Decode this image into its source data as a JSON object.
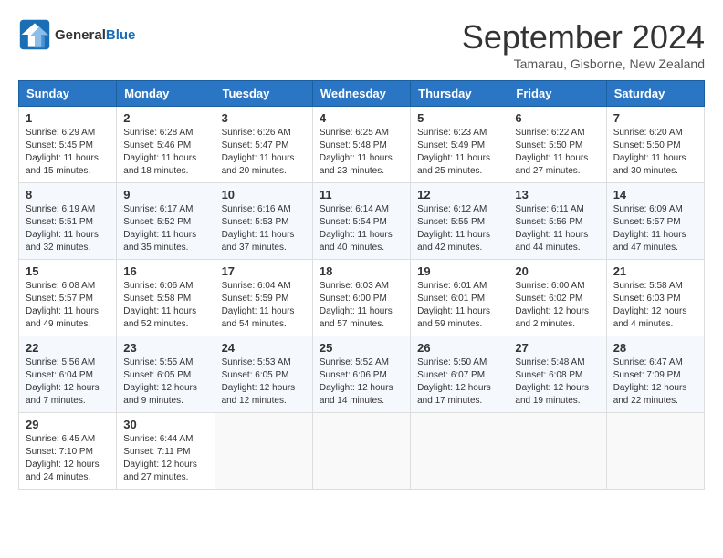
{
  "header": {
    "logo_general": "General",
    "logo_blue": "Blue",
    "month_title": "September 2024",
    "location": "Tamarau, Gisborne, New Zealand"
  },
  "weekdays": [
    "Sunday",
    "Monday",
    "Tuesday",
    "Wednesday",
    "Thursday",
    "Friday",
    "Saturday"
  ],
  "weeks": [
    [
      {
        "day": "1",
        "sunrise": "6:29 AM",
        "sunset": "5:45 PM",
        "daylight": "11 hours and 15 minutes."
      },
      {
        "day": "2",
        "sunrise": "6:28 AM",
        "sunset": "5:46 PM",
        "daylight": "11 hours and 18 minutes."
      },
      {
        "day": "3",
        "sunrise": "6:26 AM",
        "sunset": "5:47 PM",
        "daylight": "11 hours and 20 minutes."
      },
      {
        "day": "4",
        "sunrise": "6:25 AM",
        "sunset": "5:48 PM",
        "daylight": "11 hours and 23 minutes."
      },
      {
        "day": "5",
        "sunrise": "6:23 AM",
        "sunset": "5:49 PM",
        "daylight": "11 hours and 25 minutes."
      },
      {
        "day": "6",
        "sunrise": "6:22 AM",
        "sunset": "5:50 PM",
        "daylight": "11 hours and 27 minutes."
      },
      {
        "day": "7",
        "sunrise": "6:20 AM",
        "sunset": "5:50 PM",
        "daylight": "11 hours and 30 minutes."
      }
    ],
    [
      {
        "day": "8",
        "sunrise": "6:19 AM",
        "sunset": "5:51 PM",
        "daylight": "11 hours and 32 minutes."
      },
      {
        "day": "9",
        "sunrise": "6:17 AM",
        "sunset": "5:52 PM",
        "daylight": "11 hours and 35 minutes."
      },
      {
        "day": "10",
        "sunrise": "6:16 AM",
        "sunset": "5:53 PM",
        "daylight": "11 hours and 37 minutes."
      },
      {
        "day": "11",
        "sunrise": "6:14 AM",
        "sunset": "5:54 PM",
        "daylight": "11 hours and 40 minutes."
      },
      {
        "day": "12",
        "sunrise": "6:12 AM",
        "sunset": "5:55 PM",
        "daylight": "11 hours and 42 minutes."
      },
      {
        "day": "13",
        "sunrise": "6:11 AM",
        "sunset": "5:56 PM",
        "daylight": "11 hours and 44 minutes."
      },
      {
        "day": "14",
        "sunrise": "6:09 AM",
        "sunset": "5:57 PM",
        "daylight": "11 hours and 47 minutes."
      }
    ],
    [
      {
        "day": "15",
        "sunrise": "6:08 AM",
        "sunset": "5:57 PM",
        "daylight": "11 hours and 49 minutes."
      },
      {
        "day": "16",
        "sunrise": "6:06 AM",
        "sunset": "5:58 PM",
        "daylight": "11 hours and 52 minutes."
      },
      {
        "day": "17",
        "sunrise": "6:04 AM",
        "sunset": "5:59 PM",
        "daylight": "11 hours and 54 minutes."
      },
      {
        "day": "18",
        "sunrise": "6:03 AM",
        "sunset": "6:00 PM",
        "daylight": "11 hours and 57 minutes."
      },
      {
        "day": "19",
        "sunrise": "6:01 AM",
        "sunset": "6:01 PM",
        "daylight": "11 hours and 59 minutes."
      },
      {
        "day": "20",
        "sunrise": "6:00 AM",
        "sunset": "6:02 PM",
        "daylight": "12 hours and 2 minutes."
      },
      {
        "day": "21",
        "sunrise": "5:58 AM",
        "sunset": "6:03 PM",
        "daylight": "12 hours and 4 minutes."
      }
    ],
    [
      {
        "day": "22",
        "sunrise": "5:56 AM",
        "sunset": "6:04 PM",
        "daylight": "12 hours and 7 minutes."
      },
      {
        "day": "23",
        "sunrise": "5:55 AM",
        "sunset": "6:05 PM",
        "daylight": "12 hours and 9 minutes."
      },
      {
        "day": "24",
        "sunrise": "5:53 AM",
        "sunset": "6:05 PM",
        "daylight": "12 hours and 12 minutes."
      },
      {
        "day": "25",
        "sunrise": "5:52 AM",
        "sunset": "6:06 PM",
        "daylight": "12 hours and 14 minutes."
      },
      {
        "day": "26",
        "sunrise": "5:50 AM",
        "sunset": "6:07 PM",
        "daylight": "12 hours and 17 minutes."
      },
      {
        "day": "27",
        "sunrise": "5:48 AM",
        "sunset": "6:08 PM",
        "daylight": "12 hours and 19 minutes."
      },
      {
        "day": "28",
        "sunrise": "6:47 AM",
        "sunset": "7:09 PM",
        "daylight": "12 hours and 22 minutes."
      }
    ],
    [
      {
        "day": "29",
        "sunrise": "6:45 AM",
        "sunset": "7:10 PM",
        "daylight": "12 hours and 24 minutes."
      },
      {
        "day": "30",
        "sunrise": "6:44 AM",
        "sunset": "7:11 PM",
        "daylight": "12 hours and 27 minutes."
      },
      null,
      null,
      null,
      null,
      null
    ]
  ]
}
